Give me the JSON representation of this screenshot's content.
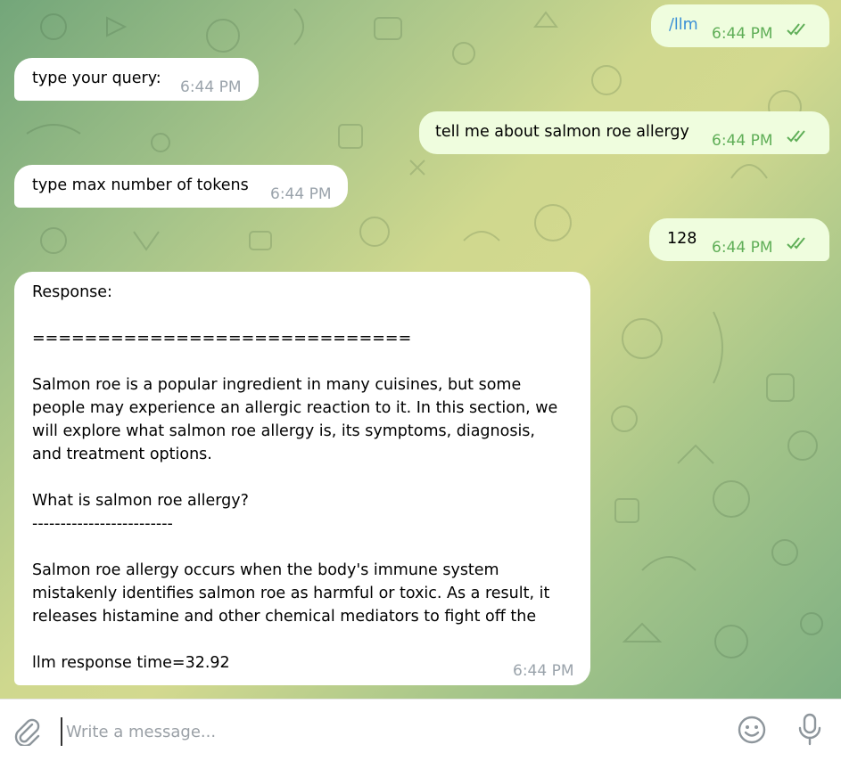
{
  "colors": {
    "incoming_bubble": "#ffffff",
    "outgoing_bubble": "#effdde",
    "outgoing_time": "#5fae57",
    "incoming_time": "#9aa3ab",
    "composer_icon": "#8e969c"
  },
  "messages": [
    {
      "direction": "outgoing",
      "text": "/llm",
      "time": "6:44 PM",
      "status": "read-double-check-icon"
    },
    {
      "direction": "incoming",
      "text": "type your query:",
      "time": "6:44 PM"
    },
    {
      "direction": "outgoing",
      "text": "tell me about salmon roe allergy",
      "time": "6:44 PM",
      "status": "read-double-check-icon"
    },
    {
      "direction": "incoming",
      "text": "type max number of tokens",
      "time": "6:44 PM"
    },
    {
      "direction": "outgoing",
      "text": "128",
      "time": "6:44 PM",
      "status": "read-double-check-icon"
    },
    {
      "direction": "incoming",
      "time": "6:44 PM",
      "text": "Response:\n\n=============================\n\nSalmon roe is a popular ingredient in many cuisines, but some\npeople may experience an allergic reaction to it. In this section, we\nwill explore what salmon roe allergy is, its symptoms, diagnosis,\nand treatment options.\n\nWhat is salmon roe allergy?\n-------------------------\n\nSalmon roe allergy occurs when the body's immune system\nmistakenly identifies salmon roe as harmful or toxic. As a result, it\nreleases histamine and other chemical mediators to fight off the\n\nllm response time=32.92"
    }
  ],
  "composer": {
    "placeholder": "Write a message...",
    "value": "",
    "attach_icon": "paperclip-icon",
    "emoji_icon": "smiley-icon",
    "voice_icon": "microphone-icon"
  }
}
